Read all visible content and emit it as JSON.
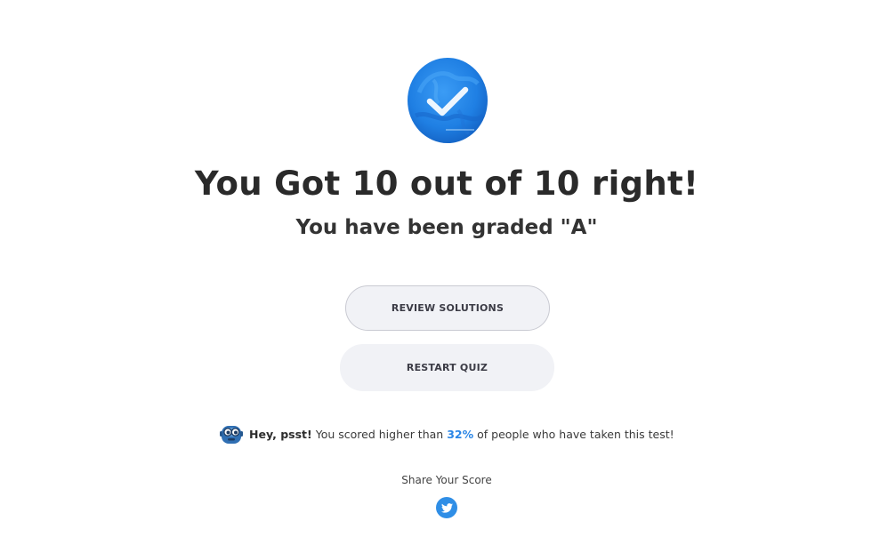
{
  "result": {
    "title": "You Got 10 out of 10 right!",
    "grade_text": "You have been graded \"A\""
  },
  "actions": {
    "review_label": "REVIEW SOLUTIONS",
    "restart_label": "RESTART QUIZ"
  },
  "psst": {
    "lead": "Hey, psst!",
    "before": "You scored higher than",
    "percent": "32%",
    "after": "of people who have taken this test!"
  },
  "share": {
    "label": "Share Your Score",
    "networks": [
      "twitter-icon"
    ]
  },
  "icons": {
    "badge": "check-badge-icon",
    "mascot": "robot-mascot-icon"
  },
  "colors": {
    "badge_blue": "#1e7fe0",
    "accent": "#2b86e6",
    "button_bg": "#f1f2f6"
  }
}
